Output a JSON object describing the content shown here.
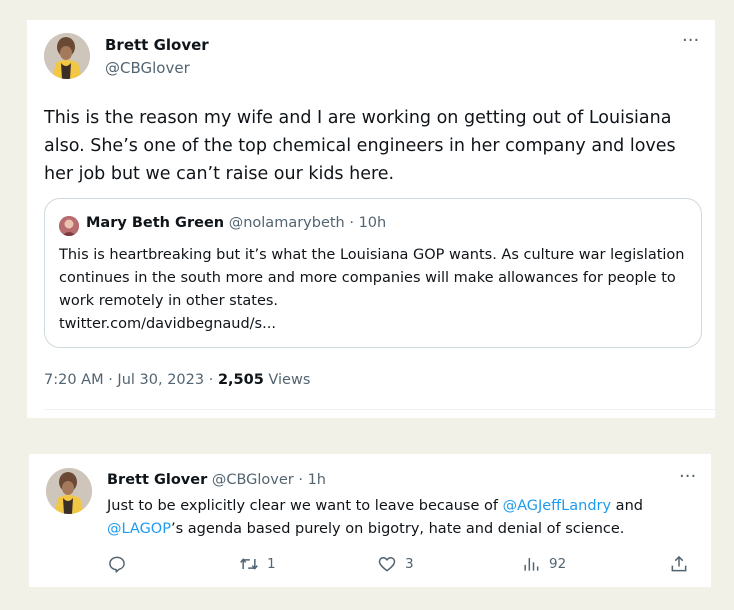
{
  "tweet": {
    "author_name": "Brett Glover",
    "author_handle": "@CBGlover",
    "more_label": "···",
    "text": "This is the reason my wife and I are working on getting out of Louisiana also. She’s one of the top chemical engineers in her company and loves her job but we can’t raise our kids here.",
    "quote": {
      "author_name": "Mary Beth Green",
      "author_handle": "@nolamarybeth",
      "time": "· 10h",
      "text": "This is heartbreaking but it’s what the Louisiana GOP wants. As culture war legislation continues in the south more and more companies will make allowances for people to work remotely in other states.",
      "link": "twitter.com/davidbegnaud/s..."
    },
    "meta": {
      "timestamp": "7:20 AM · Jul 30, 2023 · ",
      "views_count": "2,505",
      "views_label": " Views"
    }
  },
  "reply": {
    "author_name": "Brett Glover",
    "author_handle": "@CBGlover",
    "time": "· 1h",
    "more_label": "···",
    "text_part1": "Just to be explicitly clear we want to leave because of ",
    "mention1": "@AGJeffLandry",
    "text_part2": " and ",
    "mention2": "@LAGOP",
    "text_part3": "’s agenda based purely on bigotry, hate and denial of science.",
    "actions": {
      "reply_icon": "reply-icon",
      "retweet_icon": "retweet-icon",
      "retweet_count": "1",
      "like_icon": "heart-icon",
      "like_count": "3",
      "views_icon": "views-icon",
      "views_count": "92",
      "share_icon": "share-icon"
    }
  },
  "colors": {
    "background": "#f1f1e8",
    "accent": "#1d9bf0",
    "secondary_text": "#536471"
  }
}
